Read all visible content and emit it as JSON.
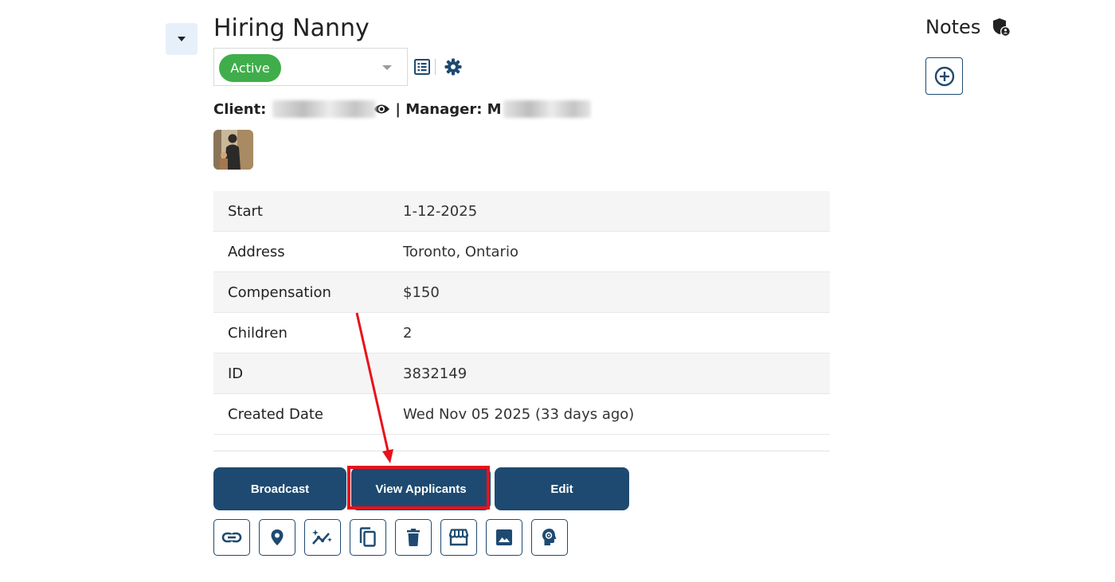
{
  "job": {
    "title": "Hiring Nanny",
    "status": "Active"
  },
  "people": {
    "client_label": "Client:",
    "manager_label": "| Manager: M"
  },
  "details": [
    {
      "label": "Start",
      "value": "1-12-2025"
    },
    {
      "label": "Address",
      "value": "Toronto, Ontario"
    },
    {
      "label": "Compensation",
      "value": "$150"
    },
    {
      "label": "Children",
      "value": "2"
    },
    {
      "label": "ID",
      "value": "3832149"
    },
    {
      "label": "Created Date",
      "value": "Wed Nov 05 2025 (33 days ago)"
    }
  ],
  "actions": {
    "broadcast": "Broadcast",
    "view_applicants": "View Applicants",
    "edit": "Edit"
  },
  "toolbar_icons": [
    "link-icon",
    "map-pin-icon",
    "analytics-sparkle-icon",
    "copy-icon",
    "trash-icon",
    "storefront-icon",
    "image-icon",
    "brain-gear-icon"
  ],
  "notes": {
    "title": "Notes"
  },
  "colors": {
    "primary": "#1e4a71",
    "status_active": "#3fae4a",
    "highlight": "#e8111c",
    "row_stripe": "#f5f5f5"
  }
}
